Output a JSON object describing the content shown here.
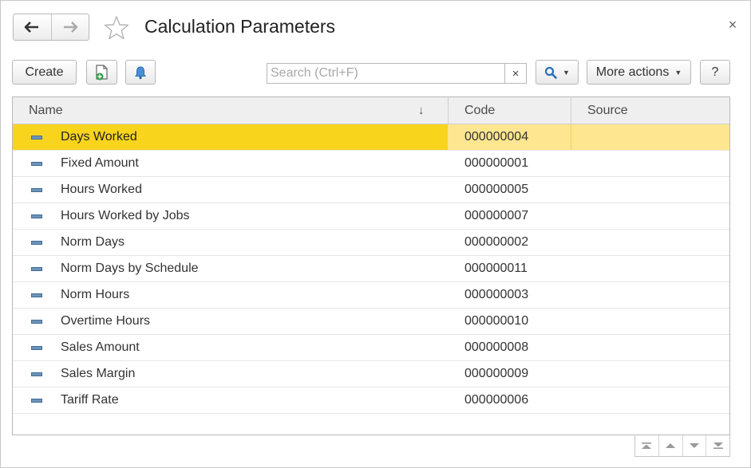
{
  "window": {
    "title": "Calculation Parameters",
    "close_glyph": "×"
  },
  "nav": {
    "back_icon": "arrow-left-icon",
    "forward_icon": "arrow-right-icon",
    "favorite_icon": "star-outline-icon"
  },
  "toolbar": {
    "create_label": "Create",
    "copy_icon": "new-document-icon",
    "notify_icon": "bell-icon",
    "search_placeholder": "Search (Ctrl+F)",
    "search_value": "",
    "clear_glyph": "×",
    "search_icon": "magnifier-icon",
    "more_actions_label": "More actions",
    "help_label": "?"
  },
  "table": {
    "columns": {
      "name": "Name",
      "code": "Code",
      "source": "Source"
    },
    "sort_glyph": "↓",
    "rows": [
      {
        "name": "Days Worked",
        "code": "000000004",
        "source": "",
        "selected": true
      },
      {
        "name": "Fixed Amount",
        "code": "000000001",
        "source": ""
      },
      {
        "name": "Hours Worked",
        "code": "000000005",
        "source": ""
      },
      {
        "name": "Hours Worked by Jobs",
        "code": "000000007",
        "source": ""
      },
      {
        "name": "Norm Days",
        "code": "000000002",
        "source": ""
      },
      {
        "name": "Norm Days by Schedule",
        "code": "000000011",
        "source": ""
      },
      {
        "name": "Norm Hours",
        "code": "000000003",
        "source": ""
      },
      {
        "name": "Overtime Hours",
        "code": "000000010",
        "source": ""
      },
      {
        "name": "Sales Amount",
        "code": "000000008",
        "source": ""
      },
      {
        "name": "Sales Margin",
        "code": "000000009",
        "source": ""
      },
      {
        "name": "Tariff Rate",
        "code": "000000006",
        "source": ""
      }
    ]
  },
  "colors": {
    "selected_row_name": "#f9d41d",
    "selected_row": "#fde68f",
    "item_icon": "#6f93b6",
    "search_icon": "#2a6fb8",
    "bell_icon": "#4a8fd6",
    "doc_plus": "#33a14a"
  },
  "scroll_controls": [
    "scroll-to-top-icon",
    "scroll-up-icon",
    "scroll-down-icon",
    "scroll-to-bottom-icon"
  ]
}
